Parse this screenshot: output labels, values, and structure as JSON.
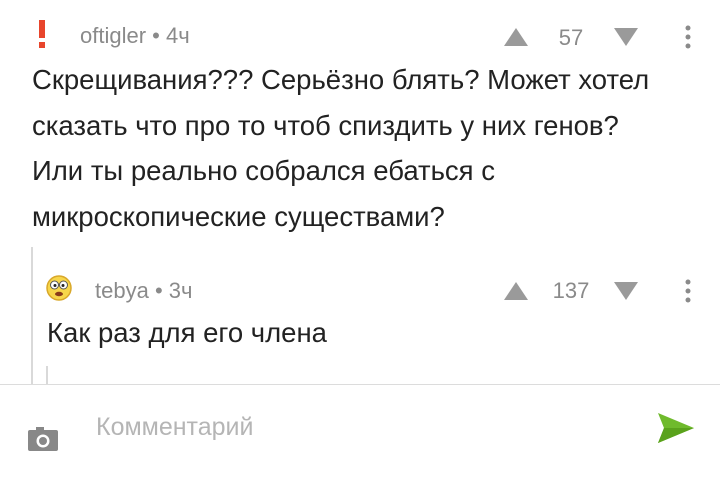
{
  "comments": [
    {
      "username": "oftigler",
      "time": "4ч",
      "score": "57",
      "text": "Скрещивания??? Серьёзно блять? Может хотел сказать что про то чтоб спиздить у них генов? Или ты реально собрался ебаться с микроскопические существами?",
      "avatar_icon": "exclamation-icon"
    },
    {
      "username": "tebya",
      "time": "3ч",
      "score": "137",
      "text": "Как раз для его члена",
      "avatar_icon": "smiley-face-icon"
    }
  ],
  "composer": {
    "placeholder": "Комментарий"
  },
  "colors": {
    "muted": "#8a8a8a",
    "accent_green": "#6fba2c",
    "exclamation": "#e8452c",
    "vote_gray": "#9a9a9a"
  }
}
